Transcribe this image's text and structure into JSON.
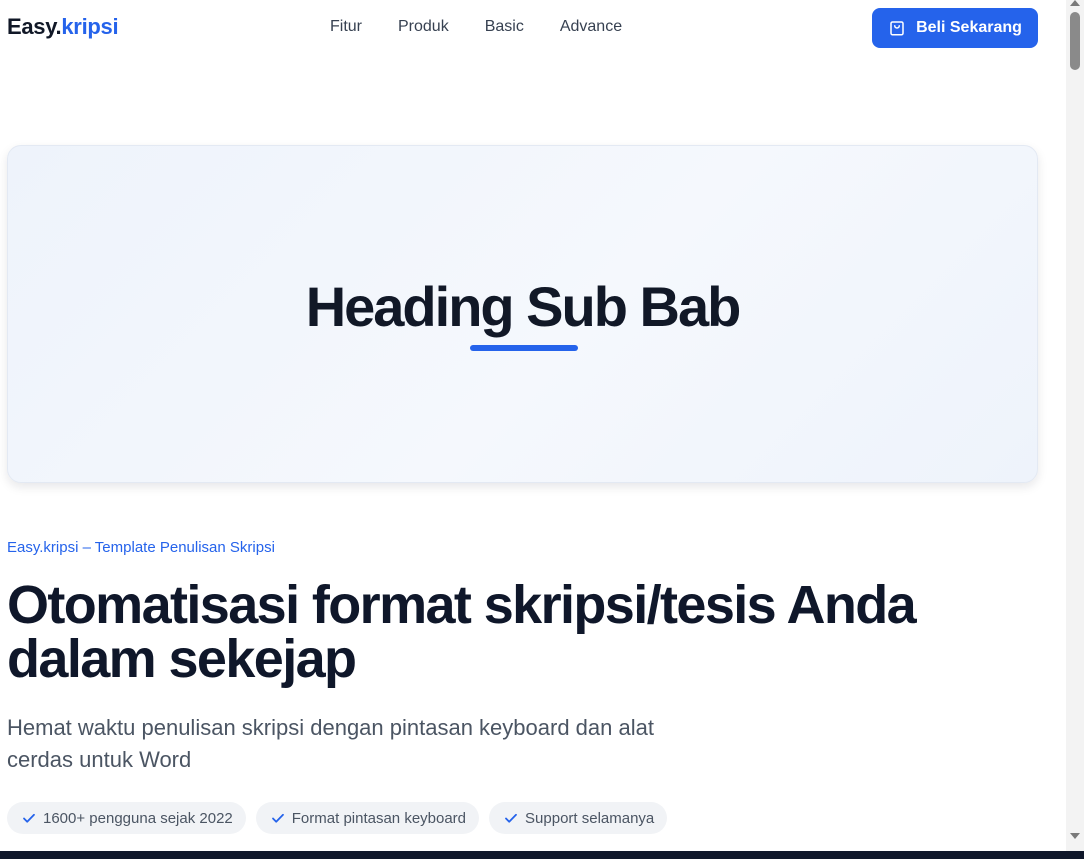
{
  "brand": {
    "part1": "Easy.",
    "part2": "kripsi",
    "accent_color": "#2563eb"
  },
  "nav": {
    "items": [
      "Fitur",
      "Produk",
      "Basic",
      "Advance"
    ]
  },
  "cta": {
    "label": "Beli Sekarang",
    "icon": "shopping-bag-icon"
  },
  "hero_card": {
    "title": "Heading Sub Bab"
  },
  "intro": {
    "eyebrow": "Easy.kripsi – Template Penulisan Skripsi",
    "headline_line1": "Otomatisasi format skripsi/tesis Anda",
    "headline_line2": "dalam sekejap",
    "subtitle_line1": "Hemat waktu penulisan skripsi dengan pintasan keyboard dan alat",
    "subtitle_line2": "cerdas untuk Word"
  },
  "badges": [
    {
      "label": "1600+ pengguna sejak 2022",
      "icon": "check-icon"
    },
    {
      "label": "Format pintasan keyboard",
      "icon": "check-icon"
    },
    {
      "label": "Support selamanya",
      "icon": "check-icon"
    }
  ]
}
